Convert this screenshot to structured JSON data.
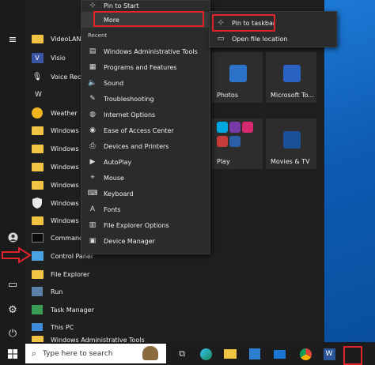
{
  "context_menu": {
    "pin_to_start": "Pin to Start",
    "more": "More",
    "recent_header": "Recent",
    "recent_items": [
      "Windows Administrative Tools",
      "Programs and Features",
      "Sound",
      "Troubleshooting",
      "Internet Options",
      "Ease of Access Center",
      "Devices and Printers",
      "AutoPlay",
      "Mouse",
      "Keyboard",
      "Fonts",
      "File Explorer Options",
      "Device Manager"
    ]
  },
  "submenu": {
    "pin_to_taskbar": "Pin to taskbar",
    "open_file_location": "Open file location"
  },
  "app_list": {
    "items": [
      "VideoLAN",
      "Visio",
      "Voice Record",
      "W",
      "Weather",
      "Windows Acc",
      "Windows Ad",
      "Windows Eas",
      "Windows Po",
      "Windows Sec",
      "Windows Sys",
      "Command",
      "Control Panel",
      "File Explorer",
      "Run",
      "Task Manager",
      "This PC",
      "Windows Administrative Tools"
    ]
  },
  "tiles": {
    "photos": "Photos",
    "todo": "Microsoft To...",
    "play": "Play",
    "movies": "Movies & TV"
  },
  "taskbar": {
    "search_placeholder": "Type here to search"
  },
  "colors": {
    "highlight": "#e0222a",
    "folder": "#f2c443",
    "accent": "#0078d7"
  }
}
